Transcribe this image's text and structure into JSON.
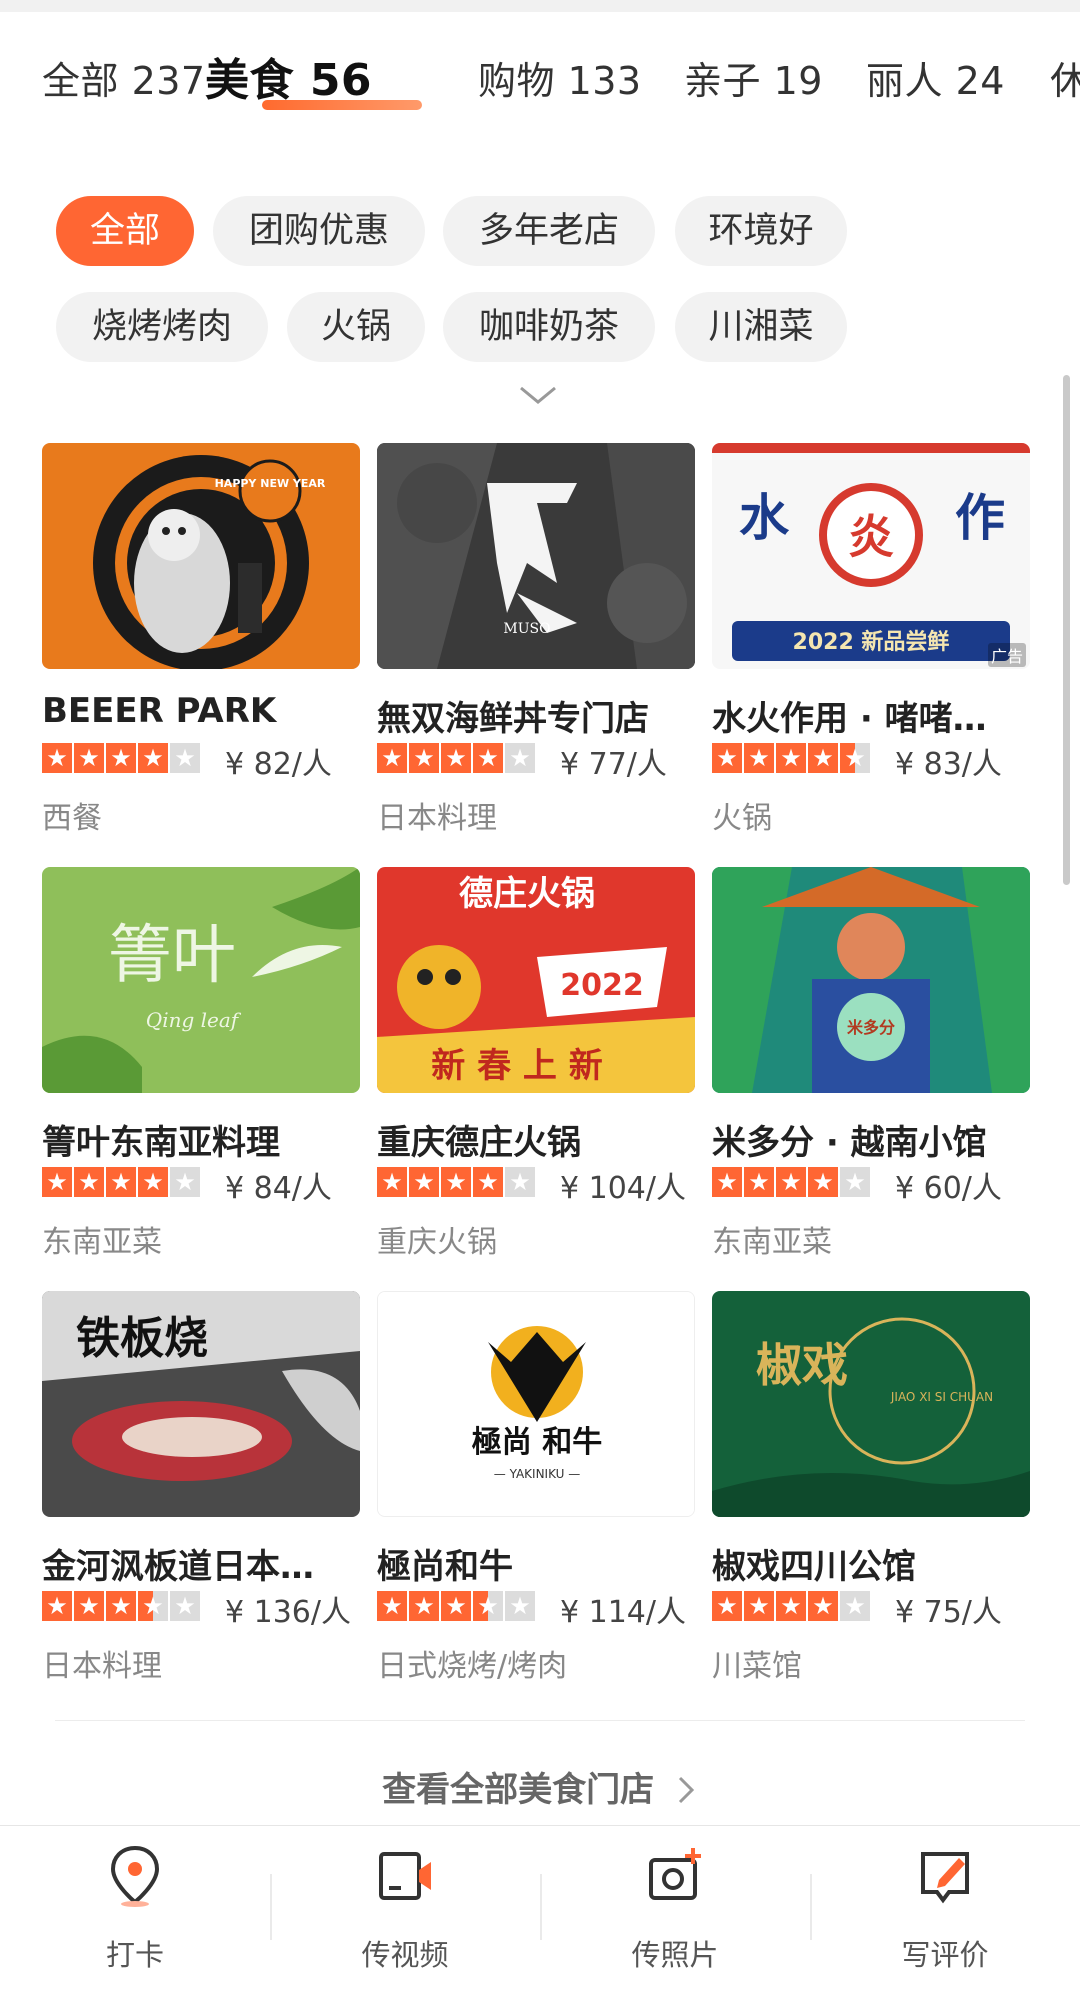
{
  "tabs": [
    {
      "label": "全部 237"
    },
    {
      "label": "美食 56"
    },
    {
      "label": "购物 133"
    },
    {
      "label": "亲子 19"
    },
    {
      "label": "丽人 24"
    },
    {
      "label": "休"
    }
  ],
  "filters": [
    {
      "label": "全部"
    },
    {
      "label": "团购优惠"
    },
    {
      "label": "多年老店"
    },
    {
      "label": "环境好"
    },
    {
      "label": "烧烤烤肉"
    },
    {
      "label": "火锅"
    },
    {
      "label": "咖啡奶茶"
    },
    {
      "label": "川湘菜"
    }
  ],
  "expand_icon": "chevron-down-icon",
  "restaurants": [
    {
      "name": "BEEER PARK",
      "rating": 4.0,
      "price": "¥ 82/人",
      "category": "西餐",
      "image_text": "HAPPY NEW YEAR",
      "ad": ""
    },
    {
      "name": "無双海鲜丼专门店",
      "rating": 4.0,
      "price": "¥ 77/人",
      "category": "日本料理",
      "image_text": "MUSO",
      "ad": ""
    },
    {
      "name": "水火作用 · 啫啫…",
      "rating": 4.5,
      "price": "¥ 83/人",
      "category": "火锅",
      "image_text": "2022 新品尝鲜",
      "ad": "广告"
    },
    {
      "name": "箐叶东南亚料理",
      "rating": 4.0,
      "price": "¥ 84/人",
      "category": "东南亚菜",
      "image_text": "箐叶",
      "ad": ""
    },
    {
      "name": "重庆德庄火锅",
      "rating": 4.0,
      "price": "¥ 104/人",
      "category": "重庆火锅",
      "image_text": "德庄火锅",
      "ad": ""
    },
    {
      "name": "米多分 · 越南小馆",
      "rating": 4.0,
      "price": "¥ 60/人",
      "category": "东南亚菜",
      "image_text": "米多分",
      "ad": ""
    },
    {
      "name": "金河沨板道日本…",
      "rating": 3.5,
      "price": "¥ 136/人",
      "category": "日本料理",
      "image_text": "铁板烧",
      "ad": ""
    },
    {
      "name": "極尚和牛",
      "rating": 3.5,
      "price": "¥ 114/人",
      "category": "日式烧烤/烤肉",
      "image_text": "極尚 和牛",
      "ad": ""
    },
    {
      "name": "椒戏四川公馆",
      "rating": 4.0,
      "price": "¥ 75/人",
      "category": "川菜馆",
      "image_text": "椒戏",
      "ad": ""
    }
  ],
  "see_all": "查看全部美食门店",
  "see_all_icon": "chevron-right-icon",
  "bottom_actions": [
    {
      "label": "打卡",
      "icon": "location-pin-icon"
    },
    {
      "label": "传视频",
      "icon": "video-upload-icon"
    },
    {
      "label": "传照片",
      "icon": "photo-upload-icon"
    },
    {
      "label": "写评价",
      "icon": "write-review-icon"
    }
  ],
  "colors": {
    "accent": "#ff6633",
    "star_empty": "#dcdcdc",
    "muted": "#888888"
  }
}
